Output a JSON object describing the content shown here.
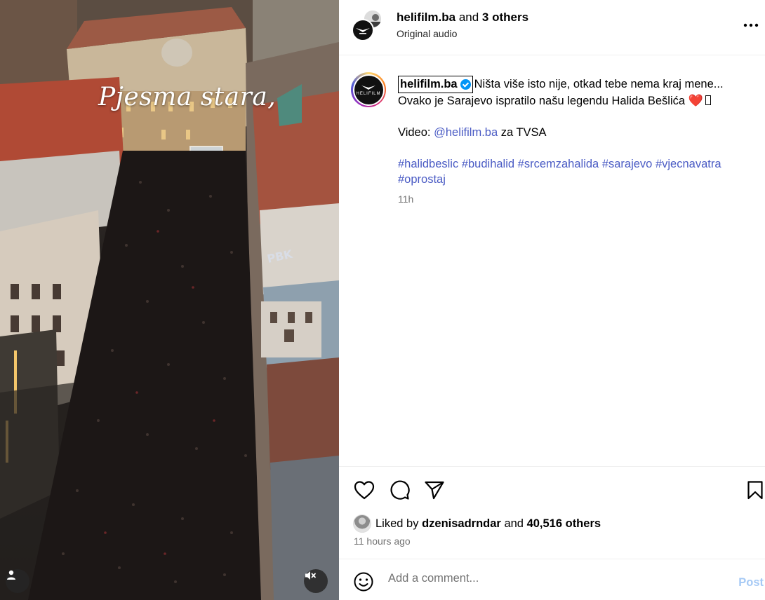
{
  "media": {
    "overlay_text": "Pjesma stara,",
    "graffiti": "PBK",
    "icons": {
      "user_tag": "person-icon",
      "mute": "speaker-muted-icon"
    }
  },
  "header": {
    "author": "helifilm.ba",
    "and_text": "and",
    "others": "3 others",
    "audio": "Original audio",
    "avatar_logo": "HELIFILM"
  },
  "caption": {
    "username": "helifilm.ba",
    "line1": "Ništa više isto nije, otkad tebe nema kraj mene...",
    "line2": "Ovako je Sarajevo ispratilo našu legendu Halida Bešlića",
    "heart": "❤️",
    "video_label": "Video:",
    "video_link": "@helifilm.ba",
    "video_suffix": "za TVSA",
    "hashtags": [
      "#halidbeslic",
      "#budihalid",
      "#srcemzahalida",
      "#sarajevo",
      "#vjecnavatra",
      "#oprostaj"
    ],
    "time": "11h"
  },
  "likes": {
    "liked_by": "Liked by",
    "user": "dzenisadrndar",
    "and_text": "and",
    "count": "40,516 others",
    "ago": "11 hours ago"
  },
  "comment": {
    "placeholder": "Add a comment...",
    "post_label": "Post"
  }
}
